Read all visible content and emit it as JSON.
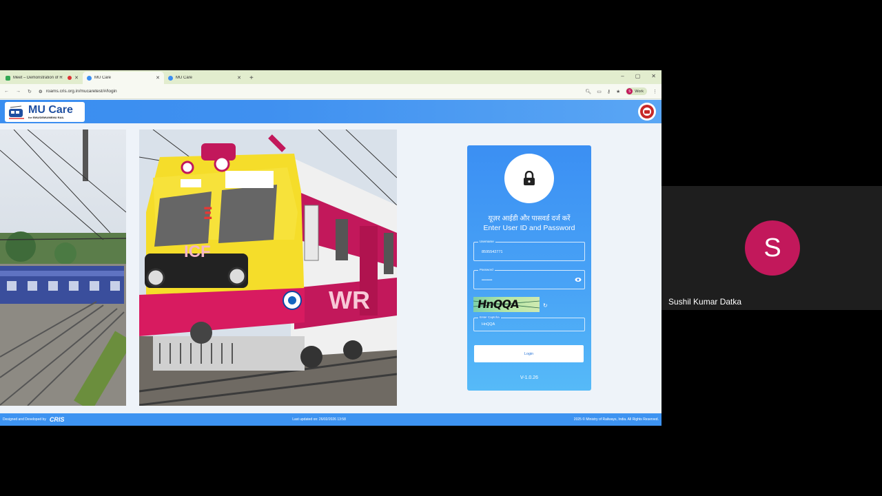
{
  "browser": {
    "tabs": [
      {
        "title": "Meet – Demonstration of R",
        "active": false
      },
      {
        "title": "MU Care",
        "active": true
      },
      {
        "title": "MU Care",
        "active": false
      }
    ],
    "new_tab": "+",
    "window_controls": {
      "minimize": "–",
      "restore": "▢",
      "close": "✕"
    },
    "url": "roams.cris.org.in/mucaretest/#/login",
    "profile_initial": "S",
    "profile_label": "Work"
  },
  "site": {
    "logo_title": "MU Care",
    "logo_subtitle": "for EMU/DEMU/MEMU RAIL",
    "login": {
      "heading_hindi": "यूज़र आईडी और पासवर्ड दर्ज करें",
      "heading_english": "Enter User ID and Password",
      "username_label": "Username",
      "username_value": "8595542771",
      "password_label": "Password",
      "password_value": "••••••••",
      "captcha_image_text": "HnQQA",
      "captcha_label": "Enter Captcha",
      "captcha_value": "HnQQA",
      "login_button": "Login",
      "version": "V-1.0.26"
    },
    "footer": {
      "designed_by": "Designed and Developed by",
      "cris": "CRIS",
      "last_updated": "Last updated on: 26/02/2026 13:58",
      "copyright": "2025 © Ministry of Railways, India. All Rights Reserved."
    },
    "train_marks": {
      "cab_text": "ICF",
      "side_text": "WR",
      "cab_symbol": "Ξ"
    }
  },
  "meet": {
    "participant_initial": "S",
    "participant_name": "Sushil Kumar Datka",
    "avatar_color": "#c2185b"
  }
}
